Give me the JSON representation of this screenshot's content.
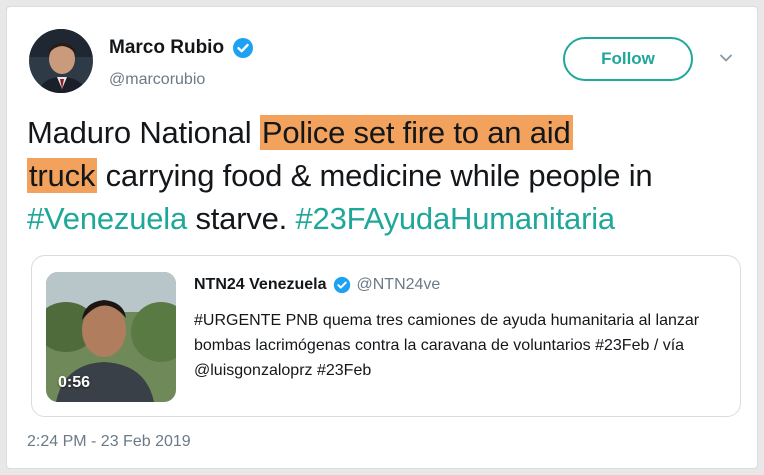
{
  "tweet": {
    "author_name": "Marco Rubio",
    "author_handle": "@marcorubio",
    "follow_label": "Follow",
    "text_part1": "Maduro National ",
    "text_highlight1": "Police set fire to an aid",
    "text_highlight2": "truck",
    "text_part2": " carrying food & medicine while people in ",
    "hashtag1": "#Venezuela",
    "text_part3": " starve. ",
    "hashtag2": "#23FAyudaHumanitaria",
    "timestamp": "2:24 PM - 23 Feb 2019"
  },
  "quoted_tweet": {
    "author_name": "NTN24 Venezuela",
    "author_handle": "@NTN24ve",
    "text": "#URGENTE PNB quema tres camiones de ayuda humanitaria al lanzar bombas lacrimógenas contra la caravana de voluntarios #23Feb / vía @luisgonzaloprz #23Feb",
    "video_duration": "0:56"
  },
  "colors": {
    "accent": "#1fa79a",
    "highlight": "#f2a25c",
    "verified": "#1da1f2"
  },
  "icons": [
    "verified-badge-icon",
    "chevron-down-icon",
    "avatar-photo",
    "video-thumbnail"
  ]
}
